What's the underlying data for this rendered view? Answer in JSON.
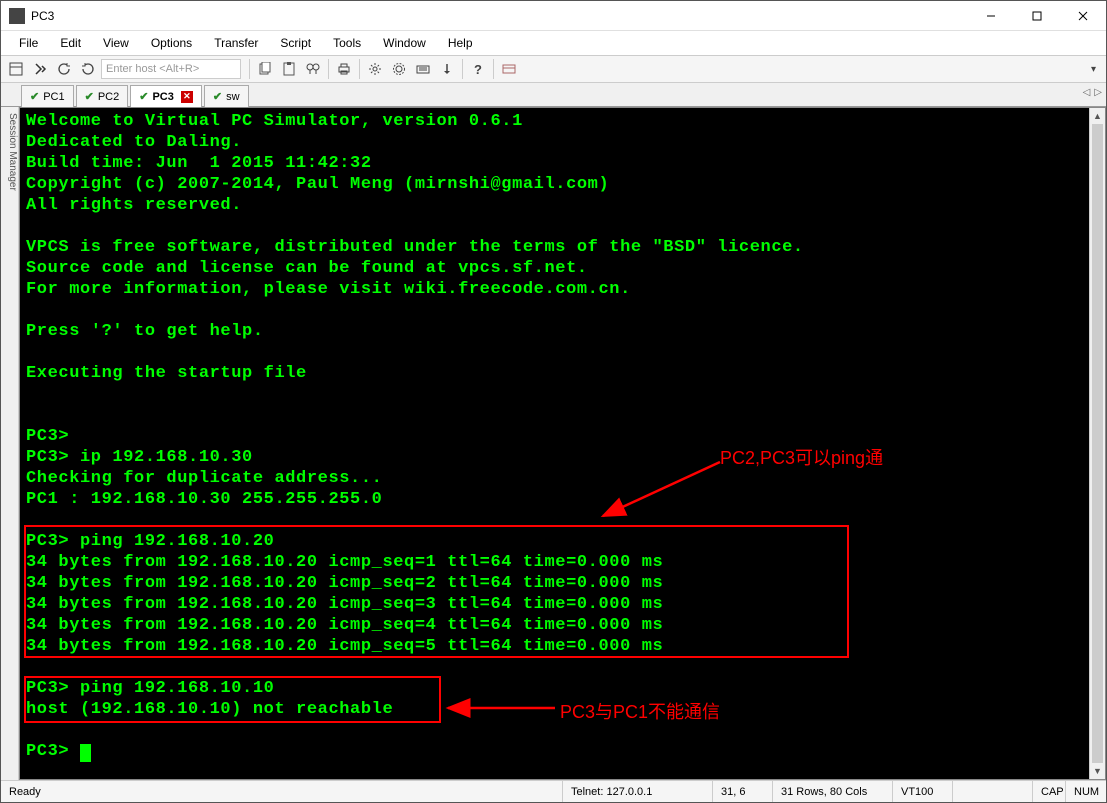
{
  "window": {
    "title": "PC3"
  },
  "menu": [
    "File",
    "Edit",
    "View",
    "Options",
    "Transfer",
    "Script",
    "Tools",
    "Window",
    "Help"
  ],
  "toolbar": {
    "host_placeholder": "Enter host <Alt+R>"
  },
  "tabs": [
    {
      "label": "PC1",
      "active": false,
      "check": true
    },
    {
      "label": "PC2",
      "active": false,
      "check": true
    },
    {
      "label": "PC3",
      "active": true,
      "check": true,
      "closeable": true
    },
    {
      "label": "sw",
      "active": false,
      "check": true
    }
  ],
  "sidebar_label": "Session Manager",
  "terminal_lines": [
    "Welcome to Virtual PC Simulator, version 0.6.1",
    "Dedicated to Daling.",
    "Build time: Jun  1 2015 11:42:32",
    "Copyright (c) 2007-2014, Paul Meng (mirnshi@gmail.com)",
    "All rights reserved.",
    "",
    "VPCS is free software, distributed under the terms of the \"BSD\" licence.",
    "Source code and license can be found at vpcs.sf.net.",
    "For more information, please visit wiki.freecode.com.cn.",
    "",
    "Press '?' to get help.",
    "",
    "Executing the startup file",
    "",
    "",
    "PC3>",
    "PC3> ip 192.168.10.30",
    "Checking for duplicate address...",
    "PC1 : 192.168.10.30 255.255.255.0",
    "",
    "PC3> ping 192.168.10.20",
    "34 bytes from 192.168.10.20 icmp_seq=1 ttl=64 time=0.000 ms",
    "34 bytes from 192.168.10.20 icmp_seq=2 ttl=64 time=0.000 ms",
    "34 bytes from 192.168.10.20 icmp_seq=3 ttl=64 time=0.000 ms",
    "34 bytes from 192.168.10.20 icmp_seq=4 ttl=64 time=0.000 ms",
    "34 bytes from 192.168.10.20 icmp_seq=5 ttl=64 time=0.000 ms",
    "",
    "PC3> ping 192.168.10.10",
    "host (192.168.10.10) not reachable",
    "",
    "PC3> "
  ],
  "annotations": {
    "a1": "PC2,PC3可以ping通",
    "a2": "PC3与PC1不能通信"
  },
  "status": {
    "ready": "Ready",
    "conn": "Telnet: 127.0.0.1",
    "pos": "31,   6",
    "size": "31 Rows, 80 Cols",
    "emu": "VT100",
    "cap": "CAP",
    "num": "NUM"
  }
}
